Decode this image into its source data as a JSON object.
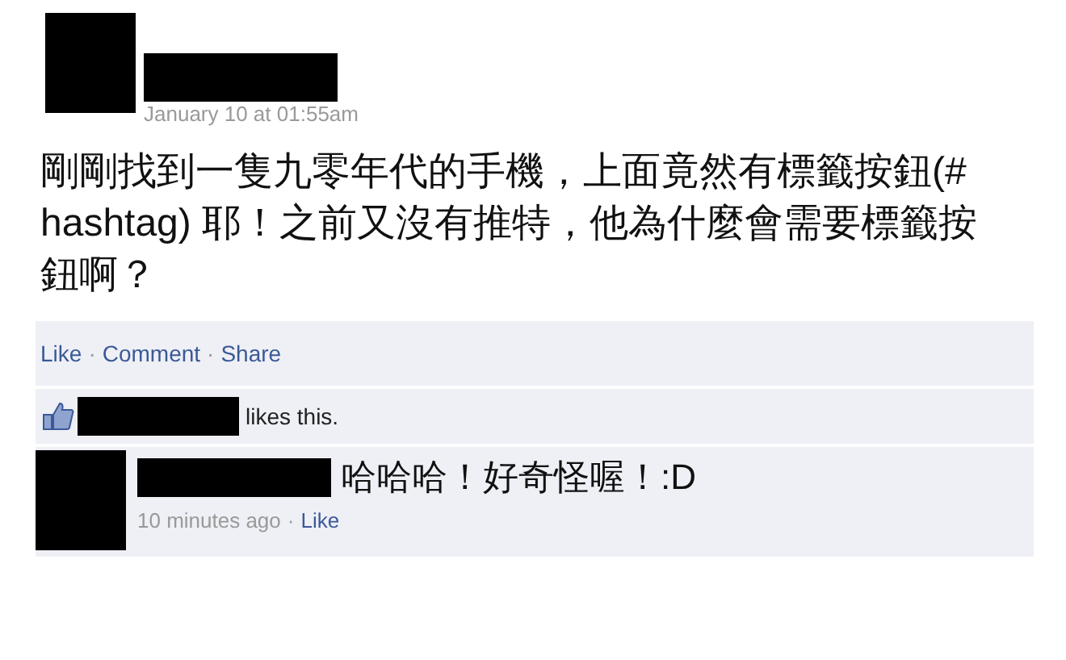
{
  "post": {
    "timestamp": "January 10 at 01:55am",
    "text": "剛剛找到一隻九零年代的手機，上面竟然有標籤按鈕(# hashtag) 耶！之前又沒有推特，他為什麼會需要標籤按鈕啊？"
  },
  "separator": "·",
  "actions": [
    "Like",
    "Comment",
    "Share"
  ],
  "likes": {
    "text": "likes this."
  },
  "comment": {
    "text": "哈哈哈！好奇怪喔！:D",
    "time": "10 minutes ago",
    "action": "Like"
  }
}
